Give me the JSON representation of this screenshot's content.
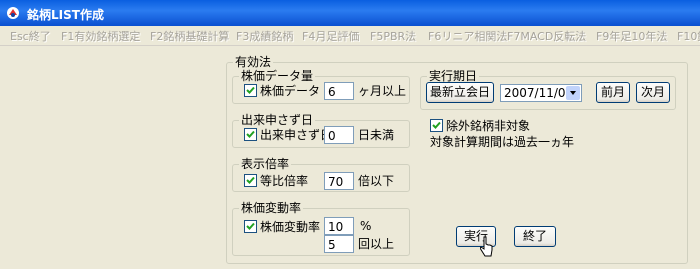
{
  "window": {
    "title": "銘柄LIST作成"
  },
  "menu": [
    "Esc終了",
    "F1有効銘柄選定",
    "F2銘柄基礎計算",
    "F3成績銘柄",
    "F4月足評価",
    "F5PBR法",
    "F6リニア相関法",
    "F7MACD反転法",
    "F9年足10年法",
    "F10銘"
  ],
  "main_group": {
    "legend": "有効法"
  },
  "price_data": {
    "legend": "株価データ量",
    "check_label": "株価データ",
    "checked": true,
    "value": "6",
    "unit": "ヶ月以上"
  },
  "no_trade": {
    "legend": "出来申さず日",
    "check_label": "出来申さず日",
    "checked": true,
    "value": "0",
    "unit": "日未満"
  },
  "display_ratio": {
    "legend": "表示倍率",
    "check_label": "等比倍率",
    "checked": true,
    "value": "70",
    "unit": "倍以下"
  },
  "volatility": {
    "legend": "株価変動率",
    "check_label": "株価変動率",
    "checked": true,
    "value": "10",
    "unit": "%",
    "count_value": "5",
    "count_unit": "回以上"
  },
  "exec_period": {
    "legend": "実行期日",
    "latest_button": "最新立会日",
    "date": "2007/11/02",
    "prev_button": "前月",
    "next_button": "次月"
  },
  "exclude": {
    "check_label": "除外銘柄非対象",
    "checked": true,
    "note": "対象計算期間は過去一ヵ年"
  },
  "actions": {
    "run": "実行",
    "quit": "終了"
  }
}
